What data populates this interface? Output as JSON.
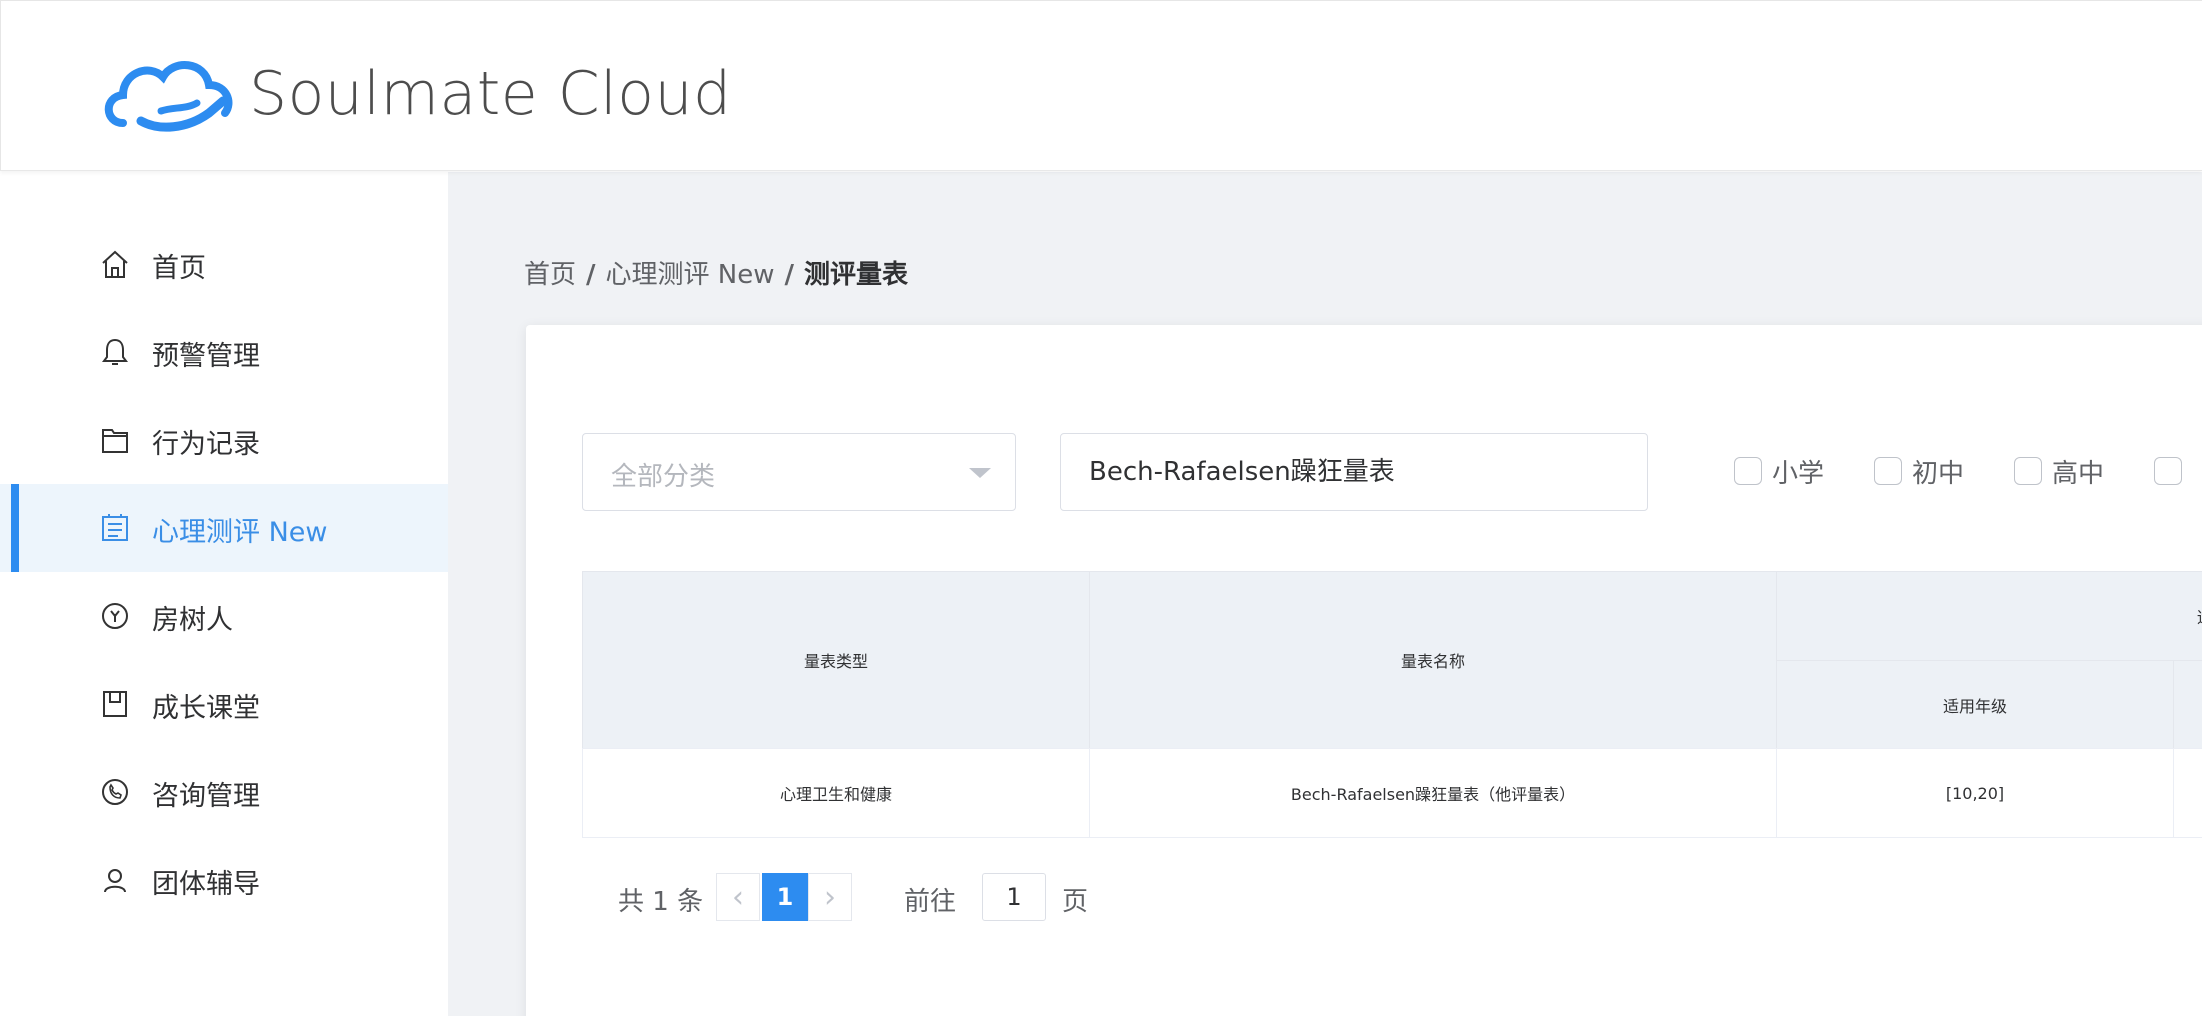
{
  "app": {
    "name": "Soulmate Cloud",
    "brand_color": "#2d8cf0"
  },
  "sidebar": {
    "items": [
      {
        "label": "首页",
        "icon": "home-icon",
        "active": false
      },
      {
        "label": "预警管理",
        "icon": "bell-icon",
        "active": false
      },
      {
        "label": "行为记录",
        "icon": "folder-icon",
        "active": false
      },
      {
        "label": "心理测评 New",
        "icon": "assessment-icon",
        "active": true
      },
      {
        "label": "房树人",
        "icon": "tree-icon",
        "active": false
      },
      {
        "label": "成长课堂",
        "icon": "book-icon",
        "active": false
      },
      {
        "label": "咨询管理",
        "icon": "phone-icon",
        "active": false
      },
      {
        "label": "团体辅导",
        "icon": "group-icon",
        "active": false
      }
    ]
  },
  "breadcrumb": {
    "items": [
      "首页",
      "心理测评 New",
      "测评量表"
    ],
    "separator": "/"
  },
  "filters": {
    "category_placeholder": "全部分类",
    "search_value": "Bech-Rafaelsen躁狂量表",
    "grade_checks": [
      {
        "label": "小学",
        "checked": false
      },
      {
        "label": "初中",
        "checked": false
      },
      {
        "label": "高中",
        "checked": false
      }
    ]
  },
  "table": {
    "headers": {
      "type": "量表类型",
      "name": "量表名称",
      "applicable_group": "适用",
      "applicable_grade": "适用年级"
    },
    "rows": [
      {
        "type": "心理卫生和健康",
        "name": "Bech-Rafaelsen躁狂量表（他评量表）",
        "grade": "[10,20]"
      }
    ]
  },
  "pagination": {
    "total_text": "共 1 条",
    "prev_symbol": "‹",
    "next_symbol": "›",
    "current_page": "1",
    "goto_label": "前往",
    "goto_value": "1",
    "page_unit": "页"
  }
}
